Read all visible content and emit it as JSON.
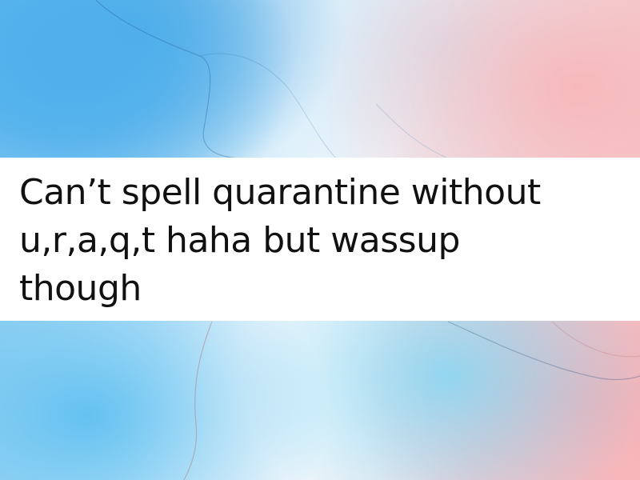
{
  "caption": {
    "lines": [
      "Can’t spell quarantine without",
      "u,r,a,q,t haha but wassup",
      "though"
    ]
  },
  "background": {
    "description_colors": [
      "#4fb0ec",
      "#7cc6f0",
      "#f4f7fa",
      "#f7bcbf",
      "#ffffff"
    ]
  },
  "text_color": "#111111"
}
